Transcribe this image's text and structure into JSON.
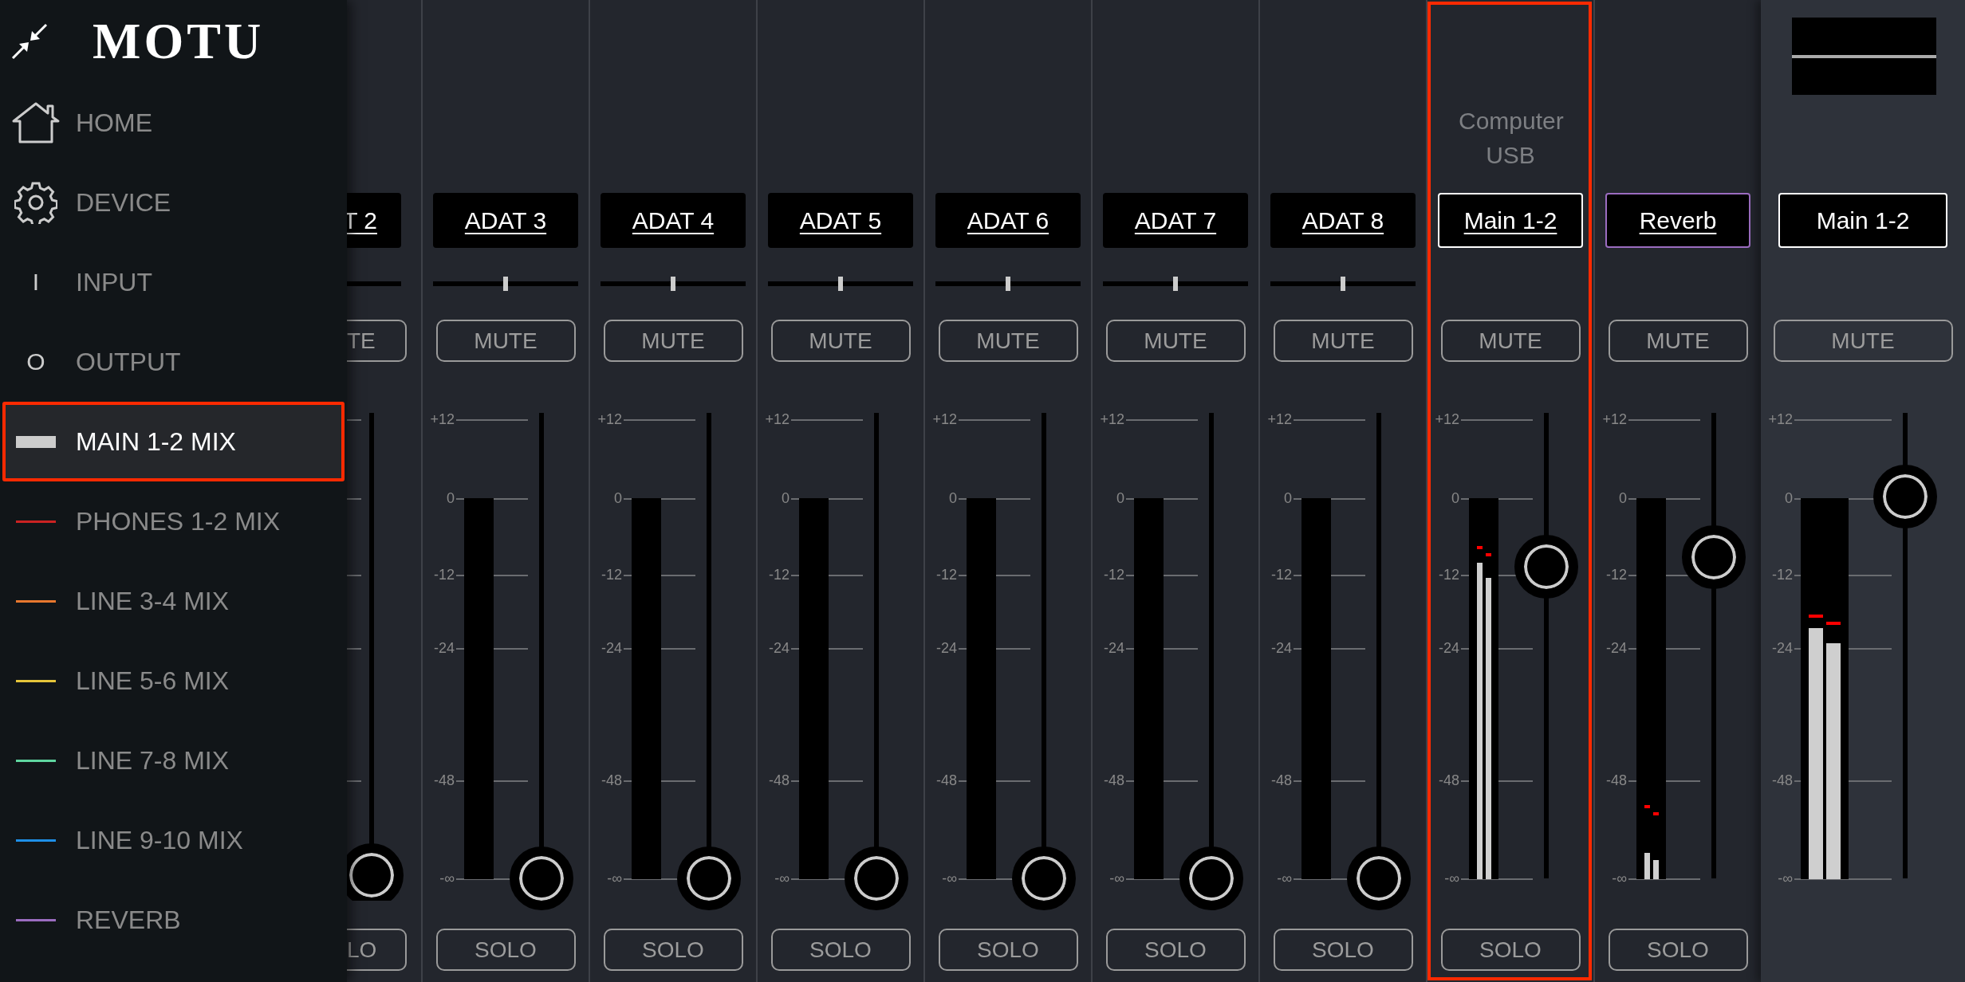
{
  "sidebar": {
    "logo": "MOTU",
    "items": [
      {
        "label": "HOME",
        "kind": "home",
        "selected": false,
        "highlighted": false
      },
      {
        "label": "DEVICE",
        "kind": "gear",
        "selected": false,
        "highlighted": false
      },
      {
        "label": "INPUT",
        "kind": "letter",
        "icon_text": "I",
        "selected": false,
        "highlighted": false
      },
      {
        "label": "OUTPUT",
        "kind": "letter",
        "icon_text": "O",
        "selected": false,
        "highlighted": false
      },
      {
        "label": "MAIN 1-2 MIX",
        "kind": "mix",
        "color": "#cccccc",
        "selected": true,
        "highlighted": true
      },
      {
        "label": "PHONES 1-2 MIX",
        "kind": "mix",
        "color": "#cc2222",
        "selected": false,
        "highlighted": false
      },
      {
        "label": "LINE 3-4 MIX",
        "kind": "mix",
        "color": "#e8772e",
        "selected": false,
        "highlighted": false
      },
      {
        "label": "LINE 5-6 MIX",
        "kind": "mix",
        "color": "#e6c53a",
        "selected": false,
        "highlighted": false
      },
      {
        "label": "LINE 7-8 MIX",
        "kind": "mix",
        "color": "#5fd6a0",
        "selected": false,
        "highlighted": false
      },
      {
        "label": "LINE 9-10 MIX",
        "kind": "mix",
        "color": "#1e8fe8",
        "selected": false,
        "highlighted": false
      },
      {
        "label": "REVERB",
        "kind": "mix",
        "color": "#9b6cc0",
        "selected": false,
        "highlighted": false
      }
    ]
  },
  "strips": [
    {
      "kind": "partial",
      "name": "T 2",
      "mute": "TE",
      "solo": "LO",
      "highlighted": false
    },
    {
      "kind": "channel",
      "name": "ADAT 3",
      "pan": {
        "level": 0.5
      },
      "mute": "MUTE",
      "scale": [
        "+12",
        "0",
        "-12",
        "-24",
        "-48",
        "-∞"
      ],
      "fader": {
        "level": 0
      },
      "solo": "SOLO",
      "highlighted": false
    },
    {
      "kind": "channel",
      "name": "ADAT 4",
      "pan": {
        "level": 0.5
      },
      "mute": "MUTE",
      "scale": [
        "+12",
        "0",
        "-12",
        "-24",
        "-48",
        "-∞"
      ],
      "fader": {
        "level": 0
      },
      "solo": "SOLO",
      "highlighted": false
    },
    {
      "kind": "channel",
      "name": "ADAT 5",
      "pan": {
        "level": 0.5
      },
      "mute": "MUTE",
      "scale": [
        "+12",
        "0",
        "-12",
        "-24",
        "-48",
        "-∞"
      ],
      "fader": {
        "level": 0
      },
      "solo": "SOLO",
      "highlighted": false
    },
    {
      "kind": "channel",
      "name": "ADAT 6",
      "pan": {
        "level": 0.5
      },
      "mute": "MUTE",
      "scale": [
        "+12",
        "0",
        "-12",
        "-24",
        "-48",
        "-∞"
      ],
      "fader": {
        "level": 0
      },
      "solo": "SOLO",
      "highlighted": false
    },
    {
      "kind": "channel",
      "name": "ADAT 7",
      "pan": {
        "level": 0.5
      },
      "mute": "MUTE",
      "scale": [
        "+12",
        "0",
        "-12",
        "-24",
        "-48",
        "-∞"
      ],
      "fader": {
        "level": 0
      },
      "solo": "SOLO",
      "highlighted": false
    },
    {
      "kind": "channel",
      "name": "ADAT 8",
      "pan": {
        "level": 0.5
      },
      "mute": "MUTE",
      "scale": [
        "+12",
        "0",
        "-12",
        "-24",
        "-48",
        "-∞"
      ],
      "fader": {
        "level": 0
      },
      "solo": "SOLO",
      "highlighted": false
    },
    {
      "kind": "channel",
      "source": "Computer USB",
      "name": "Main 1-2",
      "color": "#ffffff",
      "mute": "MUTE",
      "scale": [
        "+12",
        "0",
        "-12",
        "-24",
        "-48",
        "-∞"
      ],
      "meters": [
        {
          "level": 0.83,
          "peak": {
            "level": 0.85
          }
        },
        {
          "level": 0.79,
          "peak": {
            "level": 0.83
          }
        }
      ],
      "fader": {
        "level": 0.67
      },
      "solo": "SOLO",
      "highlighted": true
    },
    {
      "kind": "channel",
      "name": "Reverb",
      "color": "#9b6cc0",
      "mute": "MUTE",
      "scale": [
        "+12",
        "0",
        "-12",
        "-24",
        "-48",
        "-∞"
      ],
      "meters": [
        {
          "level": 0.07,
          "peak": {
            "level": 0.17
          }
        },
        {
          "level": 0.05,
          "peak": {
            "level": 0.15
          }
        }
      ],
      "fader": {
        "level": 0.69
      },
      "solo": "SOLO",
      "highlighted": false
    },
    {
      "kind": "output",
      "name": "Main 1-2",
      "color": "#ffffff",
      "mute": "MUTE",
      "scale": [
        "+12",
        "0",
        "-12",
        "-24",
        "-48",
        "-∞"
      ],
      "meters": [
        {
          "level": 0.66,
          "peak": {
            "level": 0.67
          }
        },
        {
          "level": 0.62,
          "peak": {
            "level": 0.65
          }
        }
      ],
      "fader": {
        "level": 0.82
      },
      "highlighted": false
    }
  ]
}
